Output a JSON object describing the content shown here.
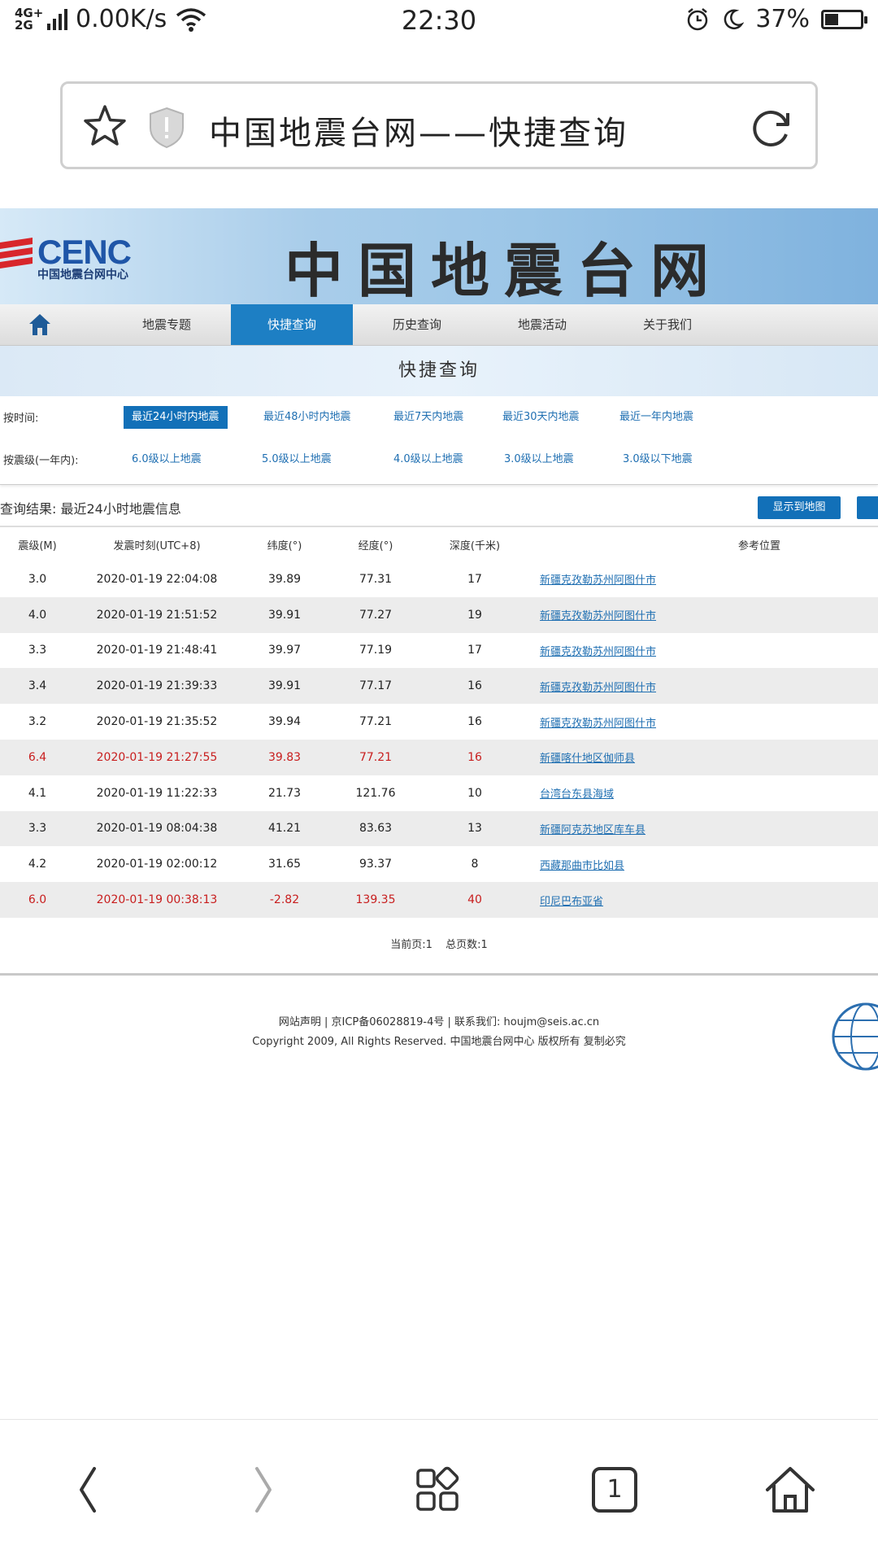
{
  "status_bar": {
    "network": "4G+\n2G",
    "speed": "0.00K/s",
    "time": "22:30",
    "battery": "37%",
    "battery_level": 0.37
  },
  "url_bar": {
    "title": "中国地震台网——快捷查询"
  },
  "site": {
    "logo_en": "CENC",
    "logo_cn": "中国地震台网中心",
    "banner_title": "中国地震台网",
    "nav": [
      "地震专题",
      "快捷查询",
      "历史查询",
      "地震活动",
      "关于我们"
    ],
    "nav_active": "快捷查询",
    "section_title": "快捷查询",
    "filter_time_label": "按时间:",
    "filter_time_options": [
      "最近24小时内地震",
      "最近48小时内地震",
      "最近7天内地震",
      "最近30天内地震",
      "最近一年内地震"
    ],
    "filter_mag_label": "按震级(一年内):",
    "filter_mag_options": [
      "6.0级以上地震",
      "5.0级以上地震",
      "4.0级以上地震",
      "3.0级以上地震",
      "3.0级以下地震"
    ],
    "result_label": "查询结果: 最近24小时地震信息",
    "map_button": "显示到地图"
  },
  "table": {
    "headers": [
      "震级(M)",
      "发震时刻(UTC+8)",
      "纬度(°)",
      "经度(°)",
      "深度(千米)",
      "参考位置"
    ],
    "rows": [
      {
        "mag": "3.0",
        "time": "2020-01-19 22:04:08",
        "lat": "39.89",
        "lon": "77.31",
        "depth": "17",
        "loc": "新疆克孜勒苏州阿图什市"
      },
      {
        "mag": "4.0",
        "time": "2020-01-19 21:51:52",
        "lat": "39.91",
        "lon": "77.27",
        "depth": "19",
        "loc": "新疆克孜勒苏州阿图什市"
      },
      {
        "mag": "3.3",
        "time": "2020-01-19 21:48:41",
        "lat": "39.97",
        "lon": "77.19",
        "depth": "17",
        "loc": "新疆克孜勒苏州阿图什市"
      },
      {
        "mag": "3.4",
        "time": "2020-01-19 21:39:33",
        "lat": "39.91",
        "lon": "77.17",
        "depth": "16",
        "loc": "新疆克孜勒苏州阿图什市"
      },
      {
        "mag": "3.2",
        "time": "2020-01-19 21:35:52",
        "lat": "39.94",
        "lon": "77.21",
        "depth": "16",
        "loc": "新疆克孜勒苏州阿图什市"
      },
      {
        "mag": "6.4",
        "time": "2020-01-19 21:27:55",
        "lat": "39.83",
        "lon": "77.21",
        "depth": "16",
        "loc": "新疆喀什地区伽师县"
      },
      {
        "mag": "4.1",
        "time": "2020-01-19 11:22:33",
        "lat": "21.73",
        "lon": "121.76",
        "depth": "10",
        "loc": "台湾台东县海域"
      },
      {
        "mag": "3.3",
        "time": "2020-01-19 08:04:38",
        "lat": "41.21",
        "lon": "83.63",
        "depth": "13",
        "loc": "新疆阿克苏地区库车县"
      },
      {
        "mag": "4.2",
        "time": "2020-01-19 02:00:12",
        "lat": "31.65",
        "lon": "93.37",
        "depth": "8",
        "loc": "西藏那曲市比如县"
      },
      {
        "mag": "6.0",
        "time": "2020-01-19 00:38:13",
        "lat": "-2.82",
        "lon": "139.35",
        "depth": "40",
        "loc": "印尼巴布亚省"
      }
    ]
  },
  "pager": {
    "current": "当前页:1",
    "total": "总页数:1"
  },
  "footer": {
    "line1": "网站声明 | 京ICP备06028819-4号 | 联系我们: houjm@seis.ac.cn",
    "line2": "Copyright 2009, All Rights Reserved. 中国地震台网中心 版权所有 复制必究"
  },
  "bottom_nav": {
    "tabs_count": "1",
    "icons": [
      "back-icon",
      "forward-icon",
      "apps-icon",
      "tabs-icon",
      "home-icon"
    ]
  },
  "colors": {
    "accent": "#1270b8",
    "alert_red": "#c81e1e",
    "link": "#1f6fb2"
  }
}
